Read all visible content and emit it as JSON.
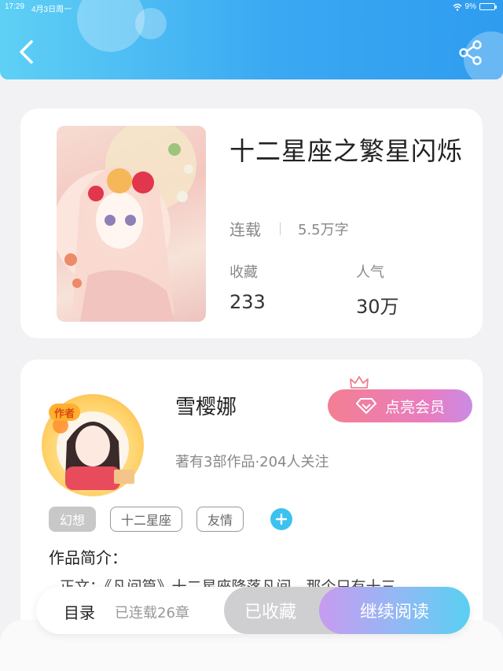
{
  "status_bar": {
    "time": "17:29",
    "date": "4月3日周一",
    "battery": "9%"
  },
  "header": {
    "back_icon": "chevron-left-icon",
    "share_icon": "share-icon"
  },
  "book": {
    "title": "十二星座之繁星闪烁",
    "status": "连载",
    "word_count": "5.5万字",
    "stats": [
      {
        "label": "收藏",
        "value": "233"
      },
      {
        "label": "人气",
        "value": "30万"
      }
    ]
  },
  "author": {
    "badge": "作者",
    "name": "雪樱娜",
    "vip_label": "点亮会员",
    "stats": "著有3部作品·204人关注"
  },
  "tags": [
    "幻想",
    "十二星座",
    "友情"
  ],
  "intro": {
    "heading": "作品简介：",
    "text": "正文：《凡间篇》十二星座降落凡间，那个只有十三"
  },
  "bottom_bar": {
    "toc_label": "目录",
    "chapter_count": "已连载26章",
    "collected_label": "已收藏",
    "read_label": "继续阅读"
  },
  "colors": {
    "accent": "#3aa8f2",
    "tag_add": "#3cc2ef",
    "vip_start": "#f37f91"
  }
}
